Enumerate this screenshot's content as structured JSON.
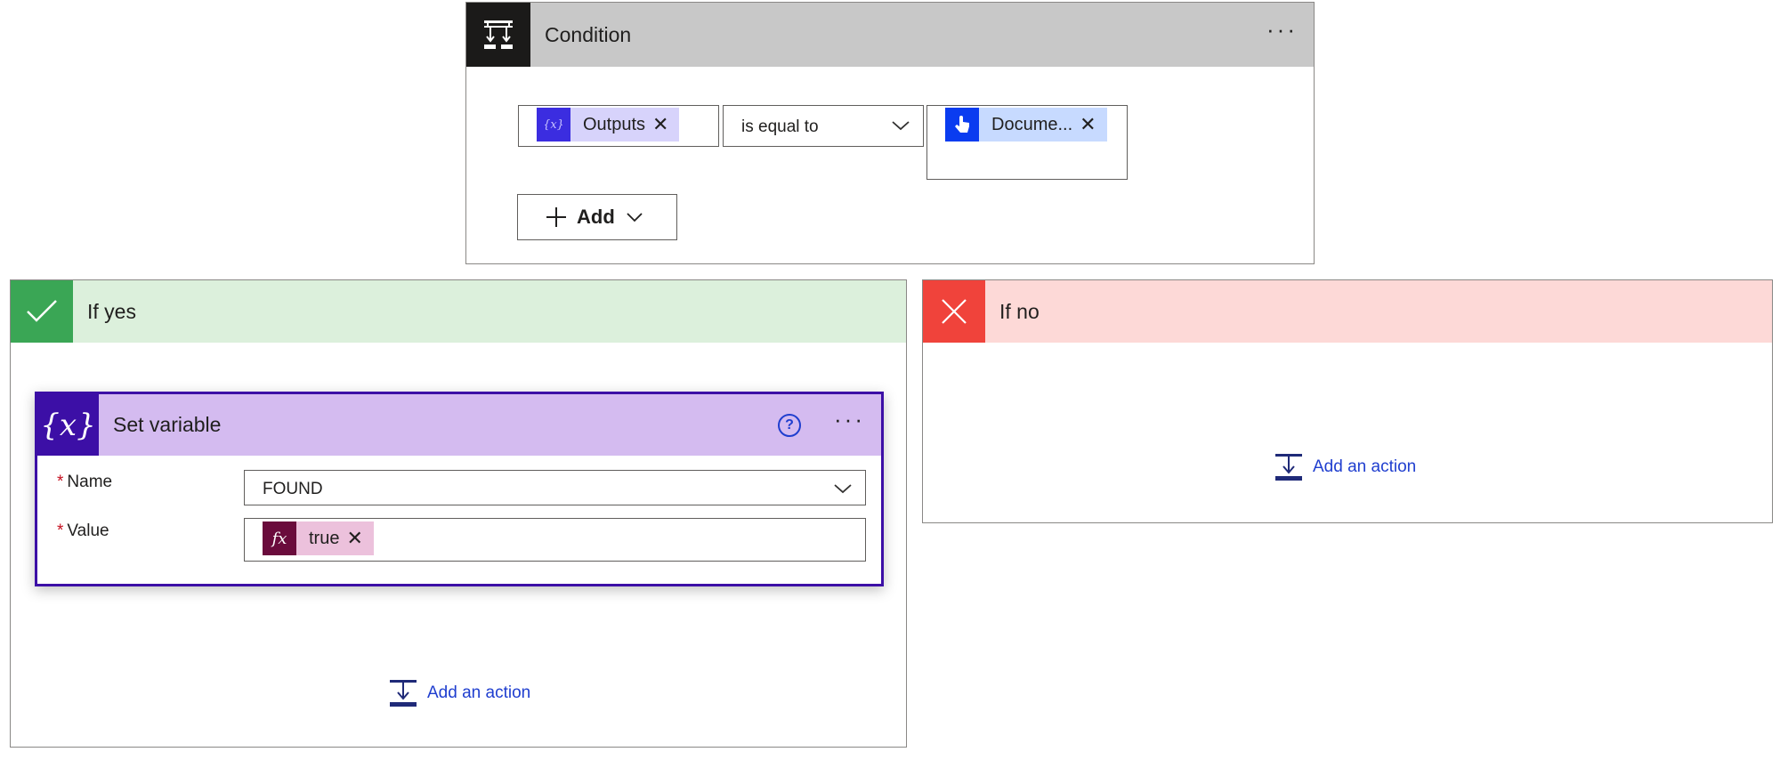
{
  "condition": {
    "title": "Condition",
    "more_label": "···",
    "icon": "condition-icon",
    "left_token": {
      "label": "Outputs",
      "icon": "variable-icon",
      "color": "#3b2de0",
      "bg": "#d7d3fb"
    },
    "operator": "is equal to",
    "right_token": {
      "label": "Docume...",
      "icon": "touch-trigger-icon",
      "color": "#0a3cf0",
      "bg": "#c7daff"
    },
    "add_label": "Add"
  },
  "if_yes": {
    "title": "If yes",
    "icon": "checkmark-icon",
    "color": "#3aa655",
    "add_action_label": "Add an action",
    "set_variable": {
      "title": "Set variable",
      "icon_text": "{𝑥}",
      "help_label": "?",
      "more_label": "···",
      "name_label": "Name",
      "name_value": "FOUND",
      "value_label": "Value",
      "value_token": {
        "label": "true",
        "icon_text": "fx",
        "color": "#6a0b3c",
        "bg": "#ecc1dc"
      }
    }
  },
  "if_no": {
    "title": "If no",
    "icon": "close-icon",
    "color": "#f0433b",
    "add_action_label": "Add an action"
  }
}
